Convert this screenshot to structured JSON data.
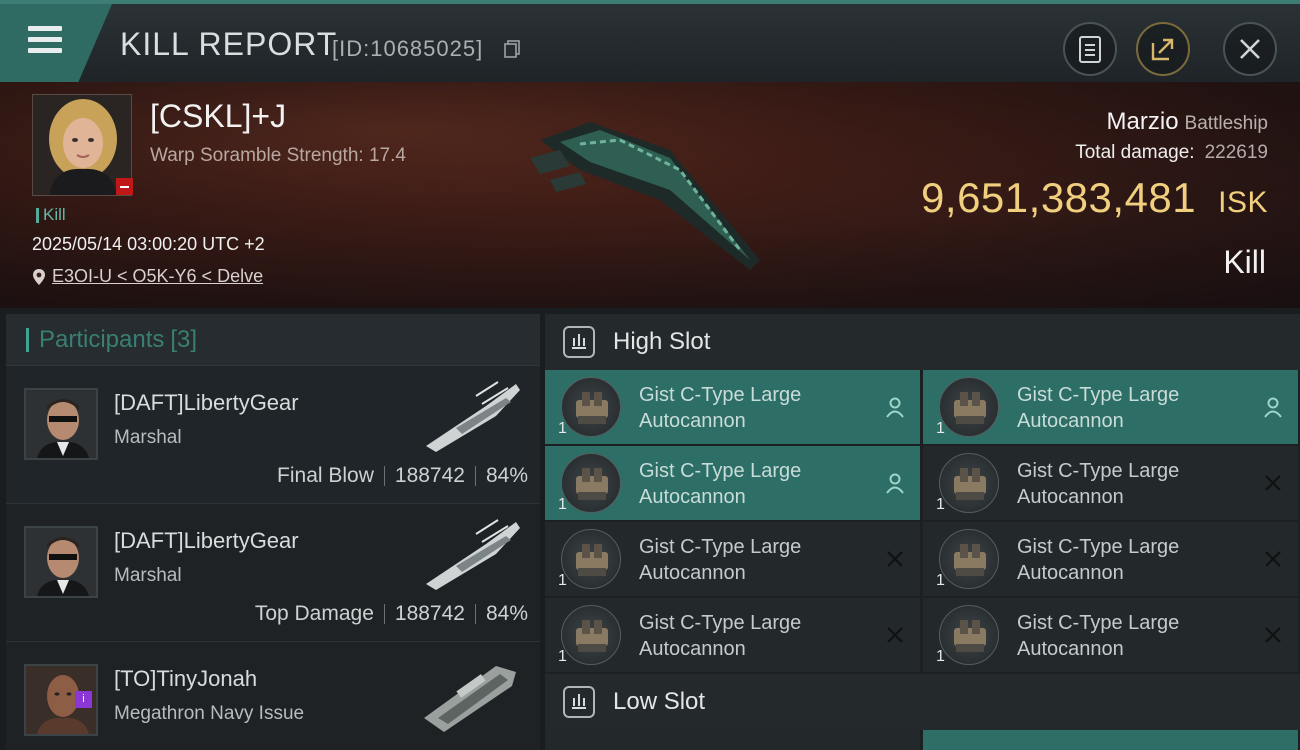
{
  "header": {
    "title": "KILL REPORT",
    "id_label": "[ID:10685025]",
    "buttons": [
      "menu-icon",
      "clipboard-icon",
      "share-icon",
      "close-icon"
    ]
  },
  "victim": {
    "name": "[CSKL]+J",
    "warp_scramble": "Warp Soramble Strength: 17.4",
    "kill_tag": "Kill",
    "datetime": "2025/05/14 03:00:20 UTC +2",
    "location": "E3OI-U < O5K-Y6 < Delve",
    "ship_name": "Marzio",
    "ship_class": "Battleship",
    "total_damage_label": "Total damage:",
    "total_damage_value": "222619",
    "isk_value": "9,651,383,481",
    "isk_unit": "ISK",
    "result": "Kill"
  },
  "participants": {
    "label": "Participants",
    "count": "[3]",
    "items": [
      {
        "name": "[DAFT]LibertyGear",
        "ship": "Marshal",
        "role": "Final Blow",
        "damage": "188742",
        "percent": "84%"
      },
      {
        "name": "[DAFT]LibertyGear",
        "ship": "Marshal",
        "role": "Top Damage",
        "damage": "188742",
        "percent": "84%"
      },
      {
        "name": "[TO]TinyJonah",
        "ship": "Megathron Navy Issue",
        "role": "",
        "damage": "",
        "percent": ""
      }
    ]
  },
  "fittings": {
    "high_slot_label": "High Slot",
    "low_slot_label": "Low Slot",
    "high_modules": [
      {
        "name_line1": "Gist C-Type Large",
        "name_line2": "Autocannon",
        "qty": "1",
        "status": "dropped"
      },
      {
        "name_line1": "Gist C-Type Large",
        "name_line2": "Autocannon",
        "qty": "1",
        "status": "dropped"
      },
      {
        "name_line1": "Gist C-Type Large",
        "name_line2": "Autocannon",
        "qty": "1",
        "status": "dropped"
      },
      {
        "name_line1": "Gist C-Type Large",
        "name_line2": "Autocannon",
        "qty": "1",
        "status": "destroyed"
      },
      {
        "name_line1": "Gist C-Type Large",
        "name_line2": "Autocannon",
        "qty": "1",
        "status": "destroyed"
      },
      {
        "name_line1": "Gist C-Type Large",
        "name_line2": "Autocannon",
        "qty": "1",
        "status": "destroyed"
      },
      {
        "name_line1": "Gist C-Type Large",
        "name_line2": "Autocannon",
        "qty": "1",
        "status": "destroyed"
      },
      {
        "name_line1": "Gist C-Type Large",
        "name_line2": "Autocannon",
        "qty": "1",
        "status": "destroyed"
      }
    ]
  },
  "colors": {
    "accent": "#2d6e66",
    "isk": "#f0cf7e",
    "badge_red": "#c01818",
    "badge_purple": "#8a37d6"
  }
}
